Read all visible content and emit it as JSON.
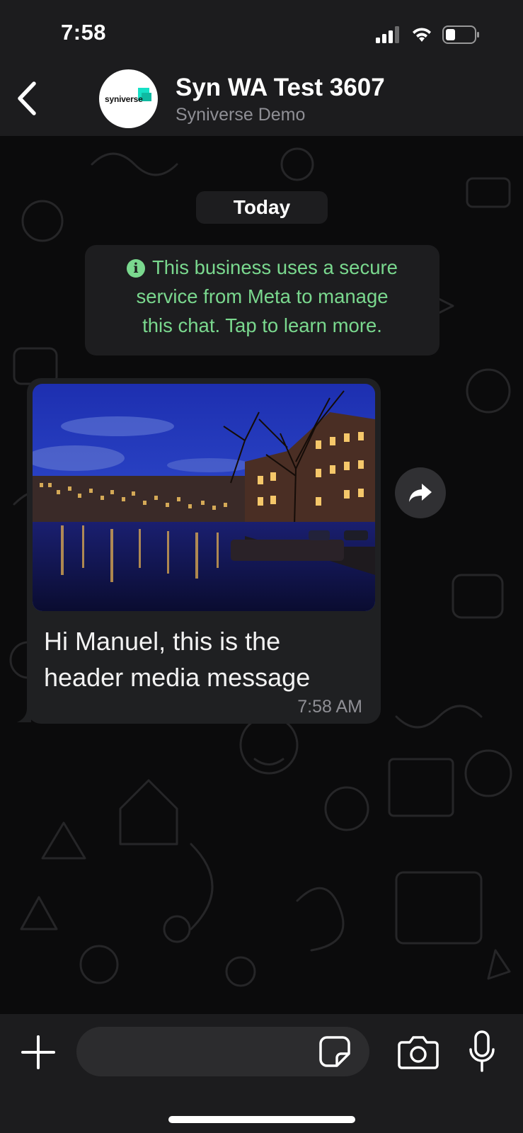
{
  "status_bar": {
    "time": "7:58"
  },
  "header": {
    "contact_name": "Syn WA Test 3607",
    "subtitle": "Syniverse Demo",
    "avatar_text": "syniverse"
  },
  "chat": {
    "date_label": "Today",
    "notice_lines": [
      "This business uses a secure",
      "service from Meta to manage",
      "this chat. Tap to learn more."
    ],
    "message": {
      "text_line1": "Hi Manuel, this is the",
      "text_line2": "header media message",
      "time": "7:58 AM"
    }
  },
  "composer": {
    "placeholder": ""
  },
  "colors": {
    "notice_green": "#7ad88e",
    "bubble_bg": "#1f2022",
    "header_bg": "#1c1c1e"
  },
  "icons": [
    "back-chevron-icon",
    "signal-icon",
    "wifi-icon",
    "battery-icon",
    "info-icon",
    "forward-icon",
    "plus-icon",
    "sticker-icon",
    "camera-icon",
    "mic-icon"
  ]
}
